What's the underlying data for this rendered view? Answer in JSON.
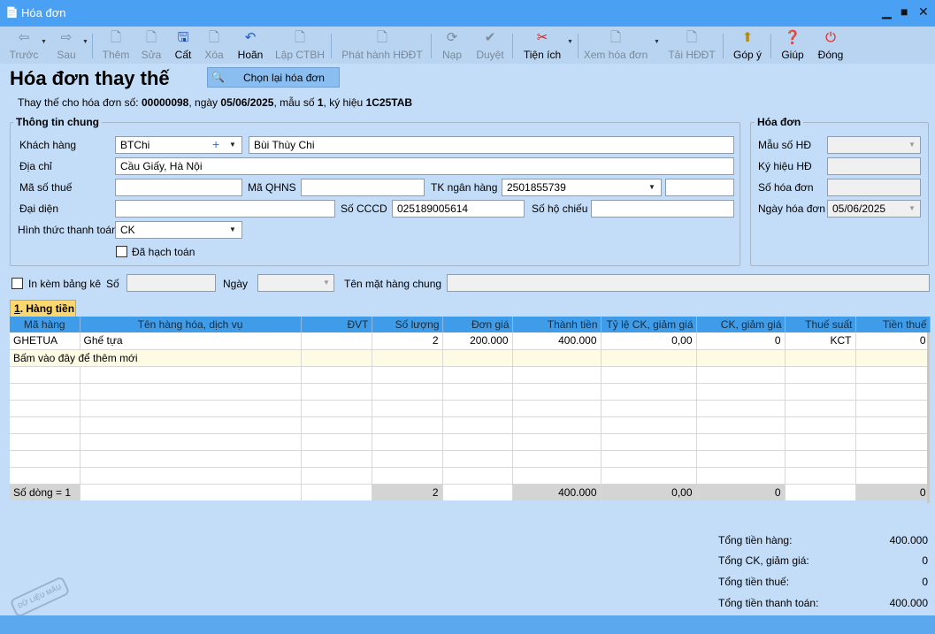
{
  "window": {
    "title": "Hóa đơn",
    "minimize": "▁",
    "maximize": "■",
    "close": "✕"
  },
  "toolbar": {
    "back": "Trước",
    "next": "Sau",
    "add": "Thêm",
    "edit": "Sửa",
    "save": "Cất",
    "delete": "Xóa",
    "undo": "Hoãn",
    "create_ctbh": "Lập CTBH",
    "issue": "Phát hành HĐĐT",
    "load": "Nạp",
    "approve": "Duyệt",
    "utilities": "Tiện ích",
    "view_invoice": "Xem hóa đơn",
    "download": "Tải HĐĐT",
    "feedback": "Góp ý",
    "help": "Giúp",
    "close": "Đóng"
  },
  "header": {
    "title": "Hóa đơn thay thế",
    "choose_button": "Chọn lại hóa đơn",
    "sub_prefix": "Thay thế cho hóa đơn số:",
    "inv_no": "00000098",
    "sub_date_label": ", ngày",
    "inv_date": "05/06/2025",
    "sub_form_label": ", mẫu số",
    "form_no": "1",
    "sub_symbol_label": ", ký hiệu",
    "symbol": "1C25TAB"
  },
  "general": {
    "title": "Thông tin chung",
    "customer_label": "Khách hàng",
    "customer_code": "BTChi",
    "customer_name": "Bùi Thùy Chi",
    "address_label": "Địa chỉ",
    "address": "Cầu Giấy, Hà Nội",
    "tax_label": "Mã số thuế",
    "tax": "",
    "qhns_label": "Mã QHNS",
    "qhns": "",
    "bank_label": "TK ngân hàng",
    "bank": "2501855739",
    "bank_extra": "",
    "rep_label": "Đại diện",
    "rep": "",
    "cccd_label": "Số CCCD",
    "cccd": "025189005614",
    "passport_label": "Số hộ chiếu",
    "passport": "",
    "payment_label": "Hình thức thanh toán",
    "payment": "CK",
    "posted_label": "Đã hạch toán"
  },
  "invoice": {
    "title": "Hóa đơn",
    "form_label": "Mẫu số HĐ",
    "form": "",
    "symbol_label": "Ký hiệu HĐ",
    "symbol": "",
    "number_label": "Số hóa đơn",
    "number": "",
    "date_label": "Ngày hóa đơn",
    "date": "05/06/2025"
  },
  "attach": {
    "label": "In kèm bảng kê",
    "no_label": "Số",
    "no": "",
    "date_label": "Ngày",
    "date": "",
    "common_label": "Tên mặt hàng chung",
    "common": ""
  },
  "tab": {
    "num": "1",
    "label": ". Hàng tiền"
  },
  "grid": {
    "columns": [
      "Mã hàng",
      "Tên hàng hóa, dịch vụ",
      "ĐVT",
      "Số lượng",
      "Đơn giá",
      "Thành tiền",
      "Tỷ lệ CK, giảm giá",
      "CK, giảm giá",
      "Thuế suất",
      "Tiền thuế"
    ],
    "rows": [
      {
        "code": "GHETUA",
        "name": "Ghế tựa",
        "unit": "",
        "qty": "2",
        "price": "200.000",
        "amount": "400.000",
        "disc_rate": "0,00",
        "disc": "0",
        "tax_rate": "KCT",
        "tax": "0"
      }
    ],
    "add_row": "Bấm vào đây để thêm mới",
    "footer": {
      "count": "Số dòng = 1",
      "qty": "2",
      "amount": "400.000",
      "disc_rate": "0,00",
      "disc": "0",
      "tax": "0"
    }
  },
  "totals": {
    "goods_label": "Tổng tiền hàng:",
    "goods": "400.000",
    "disc_label": "Tổng CK, giảm giá:",
    "disc": "0",
    "tax_label": "Tổng tiền thuế:",
    "tax": "0",
    "pay_label": "Tổng tiền thanh toán:",
    "pay": "400.000"
  },
  "watermark": "DỮ LIỆU MẪU",
  "colors": {
    "titlebar": "#4aa0f3",
    "background": "#c3dcf7",
    "grid_header": "#3f9ce8",
    "add_row": "#fefbe4"
  }
}
